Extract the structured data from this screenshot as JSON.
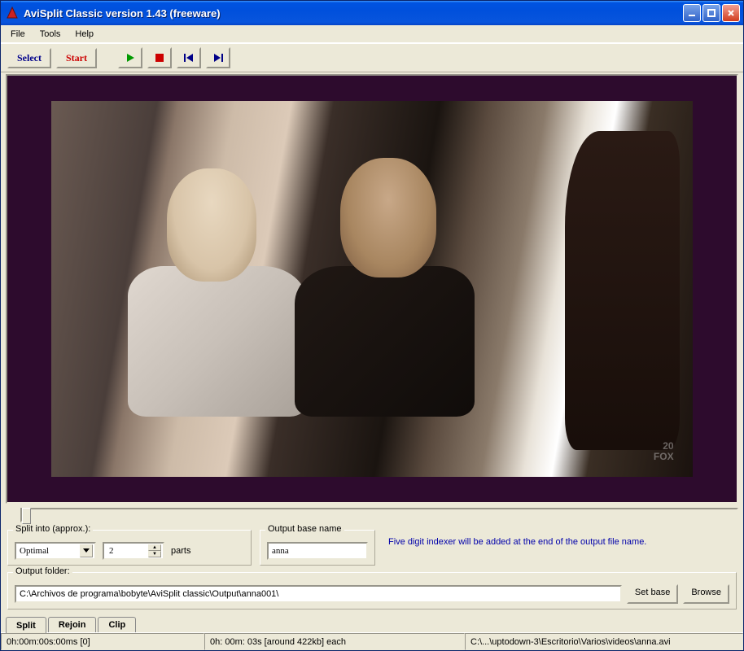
{
  "title": "AviSplit Classic version 1.43 (freeware)",
  "menu": {
    "file": "File",
    "tools": "Tools",
    "help": "Help"
  },
  "toolbar": {
    "select": "Select",
    "start": "Start"
  },
  "split": {
    "legend": "Split into (approx.):",
    "mode": "Optimal",
    "parts_value": "2",
    "parts_label": "parts"
  },
  "output_name": {
    "legend": "Output base name",
    "value": "anna"
  },
  "hint": "Five digit indexer will be added  at the end of the output file name.",
  "folder": {
    "legend": "Output folder:",
    "value": "C:\\Archivos de programa\\bobyte\\AviSplit classic\\Output\\anna001\\",
    "set_base": "Set base",
    "browse": "Browse"
  },
  "tabs": {
    "split": "Split",
    "rejoin": "Rejoin",
    "clip": "Clip"
  },
  "status": {
    "time": "0h:00m:00s:00ms [0]",
    "each": "0h: 00m: 03s  [around 422kb] each",
    "path": "C:\\...\\uptodown-3\\Escritorio\\Varios\\videos\\anna.avi"
  }
}
